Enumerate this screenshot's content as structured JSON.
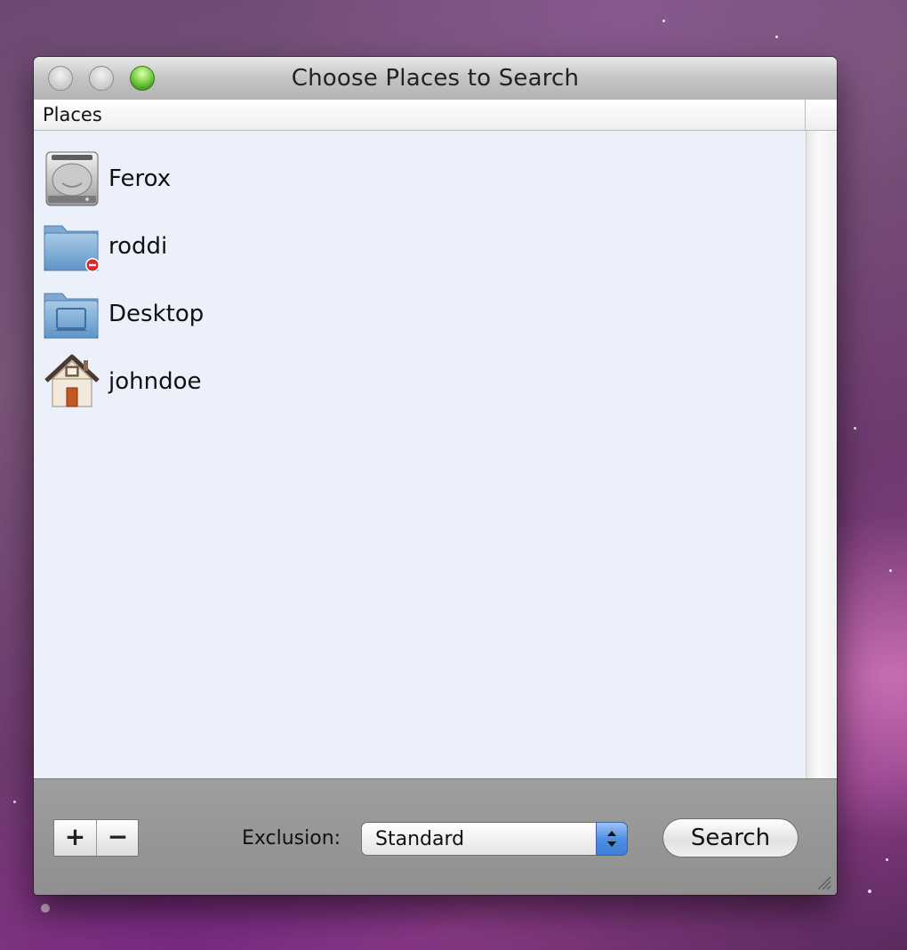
{
  "window": {
    "title": "Choose Places to Search"
  },
  "list": {
    "column_header": "Places",
    "items": [
      {
        "label": "Ferox",
        "icon": "hard-drive-icon"
      },
      {
        "label": "roddi",
        "icon": "folder-no-access-icon"
      },
      {
        "label": "Desktop",
        "icon": "desktop-folder-icon"
      },
      {
        "label": "johndoe",
        "icon": "home-icon"
      }
    ]
  },
  "bottom": {
    "add_label": "+",
    "remove_label": "−",
    "exclusion_label": "Exclusion:",
    "exclusion_value": "Standard",
    "search_label": "Search"
  }
}
